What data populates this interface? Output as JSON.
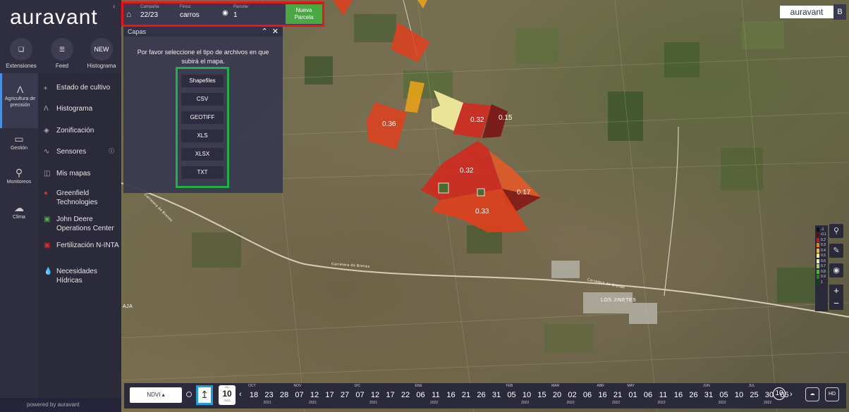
{
  "brand": {
    "logo": "auravant",
    "powered": "powered by auravant",
    "corner_logo": "auravant",
    "corner_letter": "B"
  },
  "extensions": [
    {
      "label": "Extensiones",
      "icon": "puzzle-icon"
    },
    {
      "label": "Feed",
      "icon": "feed-icon"
    },
    {
      "label": "Histograma",
      "icon": "new-badge",
      "badge": "NEW"
    }
  ],
  "nav": [
    {
      "label": "Agricultura de precisión",
      "icon": "precision-icon",
      "active": true
    },
    {
      "label": "Gestión",
      "icon": "management-icon"
    },
    {
      "label": "Monitoreos",
      "icon": "location-pin-icon"
    },
    {
      "label": "Clima",
      "icon": "cloud-icon"
    }
  ],
  "menu": [
    {
      "label": "Estado de cultivo",
      "icon": "crop-status-icon"
    },
    {
      "label": "Histograma",
      "icon": "histogram-icon"
    },
    {
      "label": "Zonificación",
      "icon": "layers-icon"
    },
    {
      "label": "Sensores",
      "icon": "sensors-icon"
    },
    {
      "label": "Mis mapas",
      "icon": "map-icon"
    },
    {
      "label": "Greenfield Technologies",
      "icon": "greenfield-icon"
    },
    {
      "label": "John Deere Operations Center",
      "icon": "john-deere-icon"
    },
    {
      "label": "Fertilización N-INTA",
      "icon": "inta-icon"
    },
    {
      "label": "Necesidades Hídricas",
      "icon": "water-drop-icon"
    }
  ],
  "toolbar": {
    "campana_label": "Campaña:",
    "campana": "22/23",
    "finca_label": "Finca:",
    "finca": "carros",
    "parcela_label": "Parcela:",
    "parcela": "1",
    "nueva": "Nueva Parcela"
  },
  "capas": {
    "title": "Capas",
    "message": "Por favor seleccione el tipo de archivos en que subirá el mapa.",
    "buttons": [
      "Shapefiles",
      "CSV",
      "GEOTIFF",
      "XLS",
      "XLSX",
      "TXT"
    ]
  },
  "parcels": [
    "0.36",
    "0.32",
    "0.15",
    "0.32",
    "0.17",
    "0.33"
  ],
  "map_labels": {
    "town": "LOS JINETES",
    "road1": "Carretera de Brenes",
    "road2": "Carretera de Brenes",
    "road3": "Carretera de Brenes",
    "left": "AJA"
  },
  "legend": [
    {
      "t": "-1",
      "c": "#111111"
    },
    {
      "t": "-0.1",
      "c": "#5a1010"
    },
    {
      "t": "0.2",
      "c": "#b22222"
    },
    {
      "t": "0.3",
      "c": "#e5802a"
    },
    {
      "t": "0.4",
      "c": "#f0b84a"
    },
    {
      "t": "0.5",
      "c": "#f7e89a"
    },
    {
      "t": "0.6",
      "c": "#e8f0b0"
    },
    {
      "t": "0.7",
      "c": "#a8d070"
    },
    {
      "t": "0.8",
      "c": "#5aaa40"
    },
    {
      "t": "0.9",
      "c": "#2a7a2a"
    },
    {
      "t": "1",
      "c": "#0a4a10"
    }
  ],
  "timeline": {
    "index": "NDVI",
    "cal_day": "10",
    "cal_month": "JUL",
    "cal_year": "2023",
    "selected": "10",
    "dates": [
      "18",
      "23",
      "28",
      "07",
      "12",
      "17",
      "27",
      "07",
      "12",
      "17",
      "22",
      "06",
      "11",
      "16",
      "21",
      "26",
      "31",
      "05",
      "10",
      "15",
      "20",
      "02",
      "06",
      "16",
      "21",
      "01",
      "06",
      "11",
      "16",
      "26",
      "31",
      "05",
      "10",
      "25",
      "30",
      "05"
    ],
    "months": [
      {
        "m": "OCT",
        "i": 0
      },
      {
        "m": "NOV",
        "i": 3
      },
      {
        "m": "DIC",
        "i": 7
      },
      {
        "m": "ENE",
        "i": 11
      },
      {
        "m": "FEB",
        "i": 17
      },
      {
        "m": "MAR",
        "i": 20
      },
      {
        "m": "ABR",
        "i": 23
      },
      {
        "m": "MAY",
        "i": 25
      },
      {
        "m": "JUN",
        "i": 30
      },
      {
        "m": "JUL",
        "i": 33
      }
    ],
    "years": [
      {
        "y": "2021",
        "i": 1
      },
      {
        "y": "2021",
        "i": 4
      },
      {
        "y": "2021",
        "i": 8
      },
      {
        "y": "2022",
        "i": 12
      },
      {
        "y": "2022",
        "i": 18
      },
      {
        "y": "2022",
        "i": 21
      },
      {
        "y": "2022",
        "i": 24
      },
      {
        "y": "2022",
        "i": 27
      },
      {
        "y": "2022",
        "i": 31
      },
      {
        "y": "2022",
        "i": 34
      }
    ],
    "hd": "HD"
  }
}
